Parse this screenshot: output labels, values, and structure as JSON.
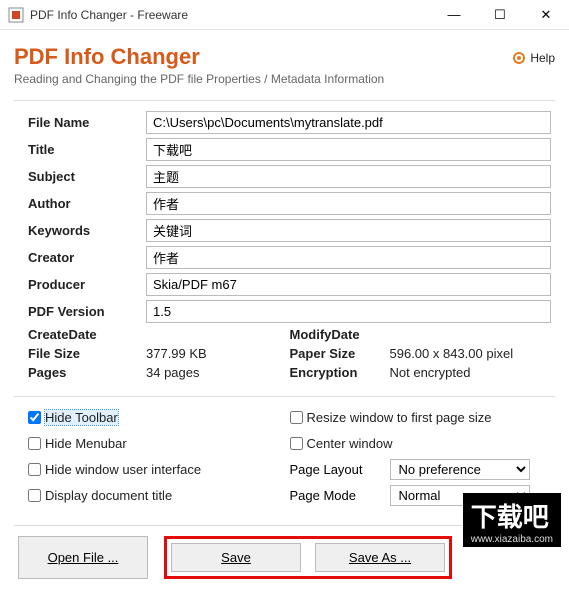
{
  "window": {
    "title": "PDF Info Changer - Freeware"
  },
  "header": {
    "app_title": "PDF Info Changer",
    "help_label": "Help",
    "tagline": "Reading and Changing the PDF file Properties / Metadata Information"
  },
  "fields": {
    "file_name": {
      "label": "File Name",
      "value": "C:\\Users\\pc\\Documents\\mytranslate.pdf"
    },
    "title": {
      "label": "Title",
      "value": "下载吧"
    },
    "subject": {
      "label": "Subject",
      "value": "主题"
    },
    "author": {
      "label": "Author",
      "value": "作者"
    },
    "keywords": {
      "label": "Keywords",
      "value": "关键词"
    },
    "creator": {
      "label": "Creator",
      "value": "作者"
    },
    "producer": {
      "label": "Producer",
      "value": "Skia/PDF m67"
    },
    "pdf_version": {
      "label": "PDF Version",
      "value": "1.5"
    }
  },
  "info": {
    "create_date": {
      "label": "CreateDate",
      "value": ""
    },
    "modify_date": {
      "label": "ModifyDate",
      "value": ""
    },
    "file_size": {
      "label": "File Size",
      "value": "377.99 KB"
    },
    "paper_size": {
      "label": "Paper Size",
      "value": "596.00 x 843.00 pixel"
    },
    "pages": {
      "label": "Pages",
      "value": "34 pages"
    },
    "encryption": {
      "label": "Encryption",
      "value": "Not encrypted"
    }
  },
  "options": {
    "hide_toolbar": "Hide Toolbar",
    "hide_menubar": "Hide Menubar",
    "hide_ui": "Hide window user interface",
    "display_title": "Display document title",
    "resize_window": "Resize window to first page size",
    "center_window": "Center window",
    "page_layout_label": "Page Layout",
    "page_layout_value": "No preference",
    "page_mode_label": "Page Mode",
    "page_mode_value": "Normal"
  },
  "buttons": {
    "open": "Open File ...",
    "save": "Save",
    "save_as": "Save As ..."
  },
  "watermark": {
    "text": "下载吧",
    "url": "www.xiazaiba.com"
  }
}
